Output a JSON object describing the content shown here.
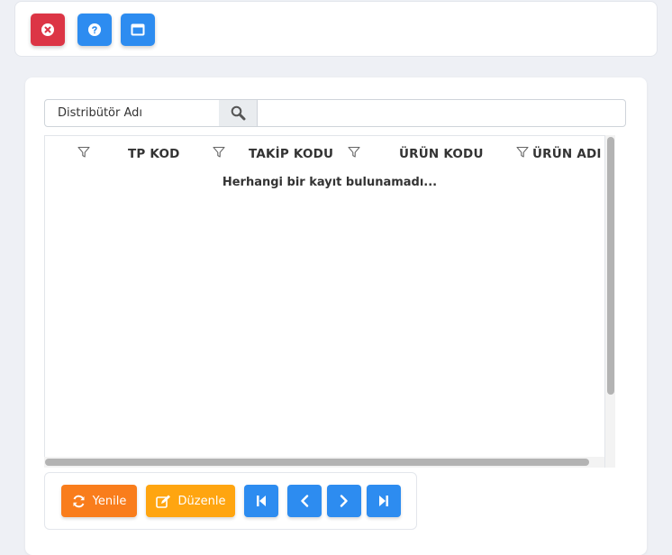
{
  "toolbar": {
    "buttons": [
      {
        "icon": "close-circle-icon",
        "color": "#dc3545"
      },
      {
        "icon": "help-circle-icon",
        "color": "#2d8cf0"
      },
      {
        "icon": "window-icon",
        "color": "#2d8cf0"
      }
    ]
  },
  "search": {
    "label": "Distribütör Adı",
    "value": ""
  },
  "grid": {
    "columns": [
      "TP KOD",
      "TAKİP KODU",
      "ÜRÜN KODU",
      "ÜRÜN ADI"
    ],
    "empty_message": "Herhangi bir kayıt bulunamadı..."
  },
  "footer": {
    "refresh_label": "Yenile",
    "edit_label": "Düzenle",
    "colors": {
      "refresh": "#f97d1c",
      "edit": "#ffa510",
      "nav": "#2d8cf0"
    }
  }
}
